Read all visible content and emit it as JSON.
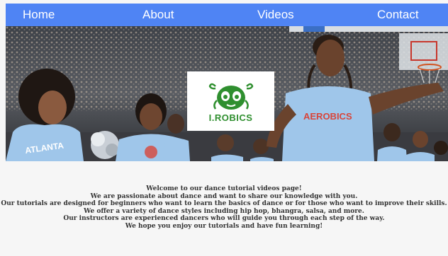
{
  "nav": {
    "home": "Home",
    "about": "About",
    "videos": "Videos",
    "contact": "Contact"
  },
  "hero": {
    "logo_text": "I.ROBICS",
    "shirt_left_text": "ATLANTA",
    "shirt_right_text": "AEROBICS"
  },
  "intro": {
    "lines": [
      "Welcome to our dance tutorial videos page!",
      "We are passionate about dance and want to share our knowledge with you.",
      "Our tutorials are designed for beginners who want to learn the basics of dance or for those who want to improve their skills.",
      "We offer a variety of dance styles including hip hop, bhangra, salsa, and more.",
      "Our instructors are experienced dancers who will guide you through each step of the way.",
      "We hope you enjoy our tutorials and have fun learning!"
    ]
  },
  "colors": {
    "nav_bg": "#4f84f4",
    "logo_green": "#2f8f2f",
    "shirt_blue": "#9fc6ea"
  }
}
